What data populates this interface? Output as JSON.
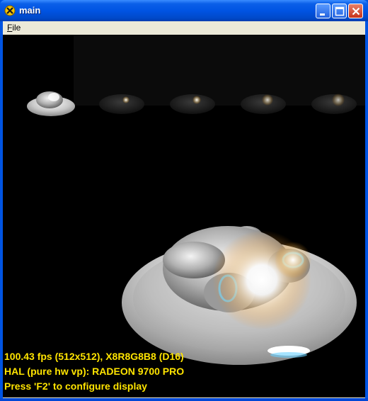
{
  "window": {
    "title": "main"
  },
  "menu": {
    "file_label": "File"
  },
  "hud": {
    "line1": "100.43 fps (512x512), X8R8G8B8 (D16)",
    "line2": "HAL (pure hw vp): RADEON 9700 PRO",
    "line3": "Press 'F2' to configure display"
  },
  "colors": {
    "hud_text": "#ffe400",
    "titlebar": "#0054e3",
    "background": "#000000"
  },
  "icons": [
    "app-icon",
    "minimize-icon",
    "maximize-icon",
    "close-icon"
  ]
}
